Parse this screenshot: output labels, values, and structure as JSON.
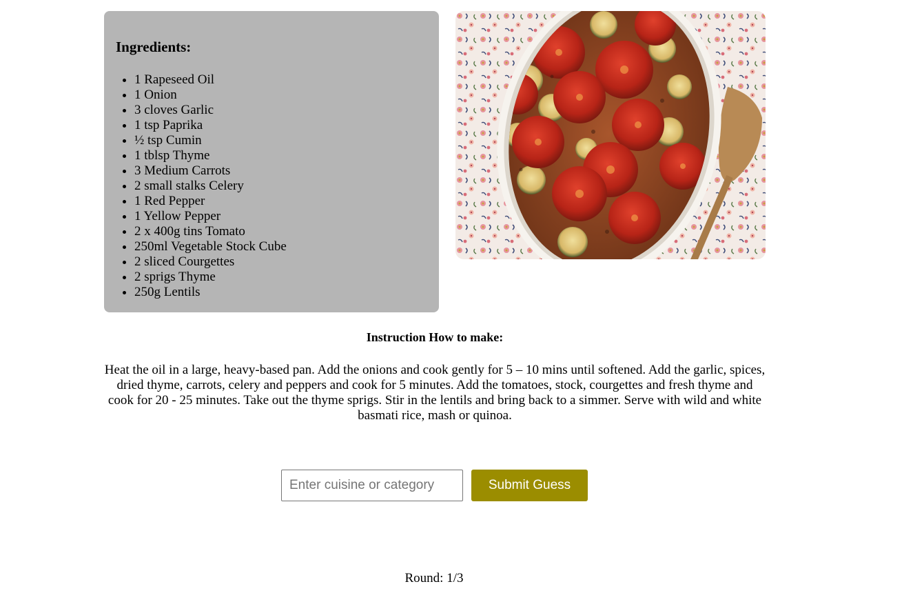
{
  "ingredients": {
    "title": "Ingredients:",
    "items": [
      "1 Rapeseed Oil",
      "1 Onion",
      "3 cloves Garlic",
      "1 tsp Paprika",
      "½ tsp Cumin",
      "1 tblsp Thyme",
      "3 Medium Carrots",
      "2 small stalks Celery",
      "1 Red Pepper",
      "1 Yellow Pepper",
      "2 x 400g tins Tomato",
      "250ml Vegetable Stock Cube",
      "2 sliced Courgettes",
      "2 sprigs Thyme",
      "250g Lentils"
    ]
  },
  "instructions": {
    "title": "Instruction How to make:",
    "text": "Heat the oil in a large, heavy-based pan. Add the onions and cook gently for 5 – 10 mins until softened. Add the garlic, spices, dried thyme, carrots, celery and peppers and cook for 5 minutes. Add the tomatoes, stock, courgettes and fresh thyme and cook for 20 - 25 minutes. Take out the thyme sprigs. Stir in the lentils and bring back to a simmer. Serve with wild and white basmati rice, mash or quinoa."
  },
  "guess": {
    "placeholder": "Enter cuisine or category",
    "value": "",
    "submit_label": "Submit Guess"
  },
  "round": {
    "text": "Round: 1/3"
  },
  "colors": {
    "card_background": "#b5b5b5",
    "submit_button": "#9b8d00",
    "page_background": "#ffffff"
  }
}
